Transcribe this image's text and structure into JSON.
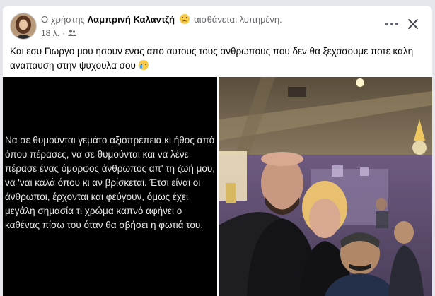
{
  "post": {
    "header_prefix": "Ο χρήστης",
    "author": "Λαμπρινή Καλαντζή",
    "feeling": "αισθάνεται λυπημένη.",
    "time": "18 λ.",
    "audience_icon": "friends-icon",
    "text": "Και εσυ Γιωργο μου ησουν ενας απο αυτους τους ανθρωπους που δεν θα ξεχασουμε ποτε καλη αναπαυση στην ψυχουλα σου"
  },
  "actions": {
    "more_icon": "more-options-icon",
    "close_icon": "close-icon"
  },
  "quote_image": {
    "text": "Να σε θυμούνται γεμάτο αξιοπρέπεια κι ήθος από όπου πέρασες, να σε θυμούνται και να λένε πέρασε ένας όμορφος άνθρωπος απ' τη ζωή μου, να 'ναι καλά όπου κι αν βρίσκεται. Έτσι είναι οι άνθρωποι, έρχονται και φεύγουν, όμως έχει μεγάλη σημασία τι χρώμα καπνό αφήνει ο καθένας πίσω του όταν θα σβήσει η φωτιά του."
  },
  "colors": {
    "page_bg": "#e4e6eb",
    "card_bg": "#ffffff",
    "meta_text": "#65676b",
    "body_text": "#050505"
  }
}
